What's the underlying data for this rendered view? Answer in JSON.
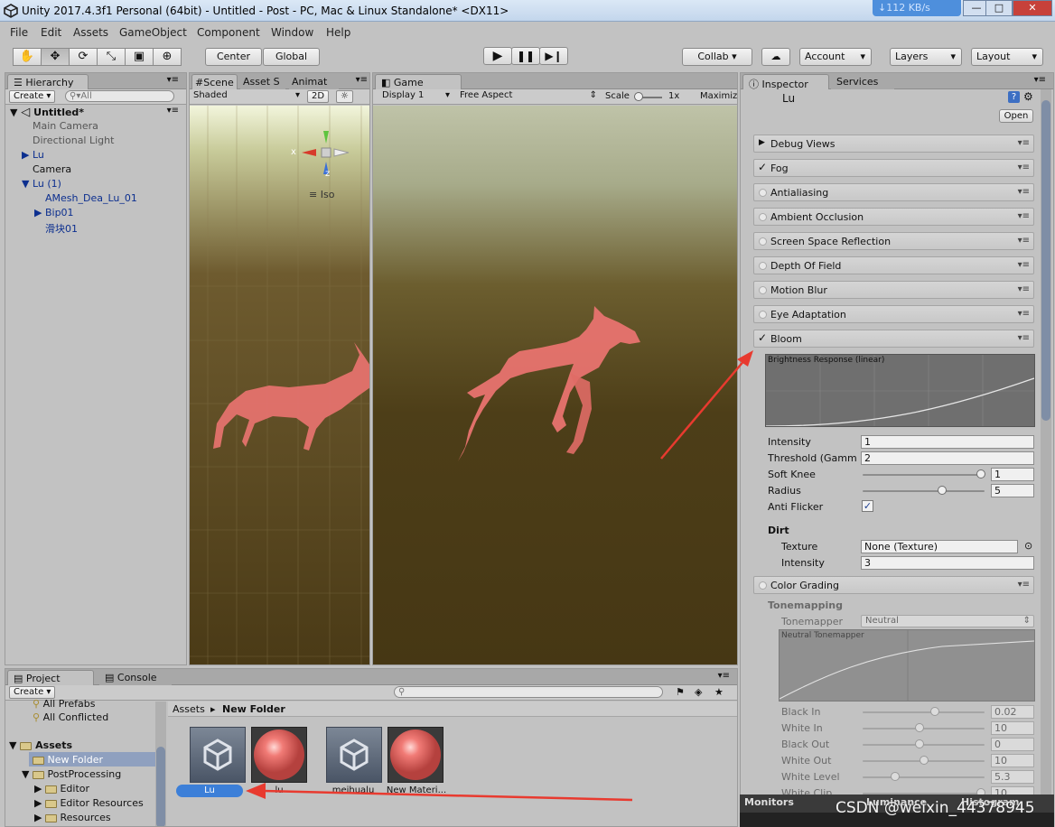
{
  "window": {
    "title": "Unity 2017.4.3f1 Personal (64bit) - Untitled - Post - PC, Mac & Linux Standalone* <DX11>",
    "net_speed": "↓112 KB/s",
    "btn_min": "—",
    "btn_max": "□",
    "btn_close": "✕"
  },
  "menu": [
    "File",
    "Edit",
    "Assets",
    "GameObject",
    "Component",
    "Window",
    "Help"
  ],
  "toolbar": {
    "center": "Center",
    "global": "Global",
    "collab": "Collab",
    "account": "Account",
    "layers": "Layers",
    "layout": "Layout"
  },
  "hierarchy": {
    "tab": "Hierarchy",
    "create": "Create",
    "search_placeholder": "All",
    "scene": "Untitled*",
    "items": [
      {
        "label": "Main Camera"
      },
      {
        "label": "Directional Light"
      },
      {
        "label": "Lu"
      },
      {
        "label": "Camera"
      },
      {
        "label": "Lu (1)"
      },
      {
        "label": "AMesh_Dea_Lu_01"
      },
      {
        "label": "Bip01"
      },
      {
        "label": "滑块01"
      }
    ]
  },
  "scene": {
    "tabs": [
      "Scene",
      "Asset S",
      "Animat"
    ],
    "shaded": "Shaded",
    "mode_2d": "2D",
    "iso": "Iso",
    "gizmo_x": "x",
    "gizmo_z": "z"
  },
  "game": {
    "tab": "Game",
    "display": "Display 1",
    "aspect": "Free Aspect",
    "scale_label": "Scale",
    "scale_value": "1x",
    "maximize": "Maximiz"
  },
  "inspector": {
    "tabs": [
      "Inspector",
      "Services"
    ],
    "object_name": "Lu",
    "open": "Open",
    "effects": [
      {
        "label": "Debug Views",
        "state": "arrow"
      },
      {
        "label": "Fog",
        "state": "check"
      },
      {
        "label": "Antialiasing",
        "state": "off"
      },
      {
        "label": "Ambient Occlusion",
        "state": "off"
      },
      {
        "label": "Screen Space Reflection",
        "state": "off"
      },
      {
        "label": "Depth Of Field",
        "state": "off"
      },
      {
        "label": "Motion Blur",
        "state": "off"
      },
      {
        "label": "Eye Adaptation",
        "state": "off"
      },
      {
        "label": "Bloom",
        "state": "check"
      }
    ],
    "bloom": {
      "graph_title": "Brightness Response (linear)",
      "intensity_label": "Intensity",
      "intensity": "1",
      "threshold_label": "Threshold (Gamm",
      "threshold": "2",
      "soft_knee_label": "Soft Knee",
      "soft_knee": "1",
      "radius_label": "Radius",
      "radius": "5",
      "anti_flicker_label": "Anti Flicker",
      "dirt_label": "Dirt",
      "texture_label": "Texture",
      "texture": "None (Texture)",
      "dirt_intensity_label": "Intensity",
      "dirt_intensity": "3"
    },
    "color_grading": {
      "label": "Color Grading",
      "tonemapping": "Tonemapping",
      "tonemapper_label": "Tonemapper",
      "tonemapper": "Neutral",
      "graph_title": "Neutral Tonemapper",
      "params": [
        {
          "label": "Black In",
          "value": "0.02",
          "pos": 0.59
        },
        {
          "label": "White In",
          "value": "10",
          "pos": 0.47
        },
        {
          "label": "Black Out",
          "value": "0",
          "pos": 0.47
        },
        {
          "label": "White Out",
          "value": "10",
          "pos": 0.5
        },
        {
          "label": "White Level",
          "value": "5.3",
          "pos": 0.27
        },
        {
          "label": "White Clip",
          "value": "10",
          "pos": 0.97
        }
      ]
    },
    "monitors": {
      "label": "Monitors",
      "luminance": "Luminance",
      "histogram": "Histogram"
    }
  },
  "project": {
    "tabs": [
      "Project",
      "Console"
    ],
    "create": "Create",
    "tree": [
      {
        "label": "All Prefabs"
      },
      {
        "label": "All Conflicted"
      },
      {
        "label": "Assets"
      },
      {
        "label": "New Folder"
      },
      {
        "label": "PostProcessing"
      },
      {
        "label": "Editor"
      },
      {
        "label": "Editor Resources"
      },
      {
        "label": "Resources"
      }
    ],
    "breadcrumb": [
      "Assets",
      "New Folder"
    ],
    "assets": [
      {
        "label": "Lu"
      },
      {
        "label": "lu"
      },
      {
        "label": "meihualu"
      },
      {
        "label": "New Materi..."
      }
    ]
  },
  "watermark": "CSDN @weixin_44378945",
  "colors": {
    "accent": "#3c7fd8",
    "arrow": "#e83a2f",
    "deer": "#e8736f"
  }
}
